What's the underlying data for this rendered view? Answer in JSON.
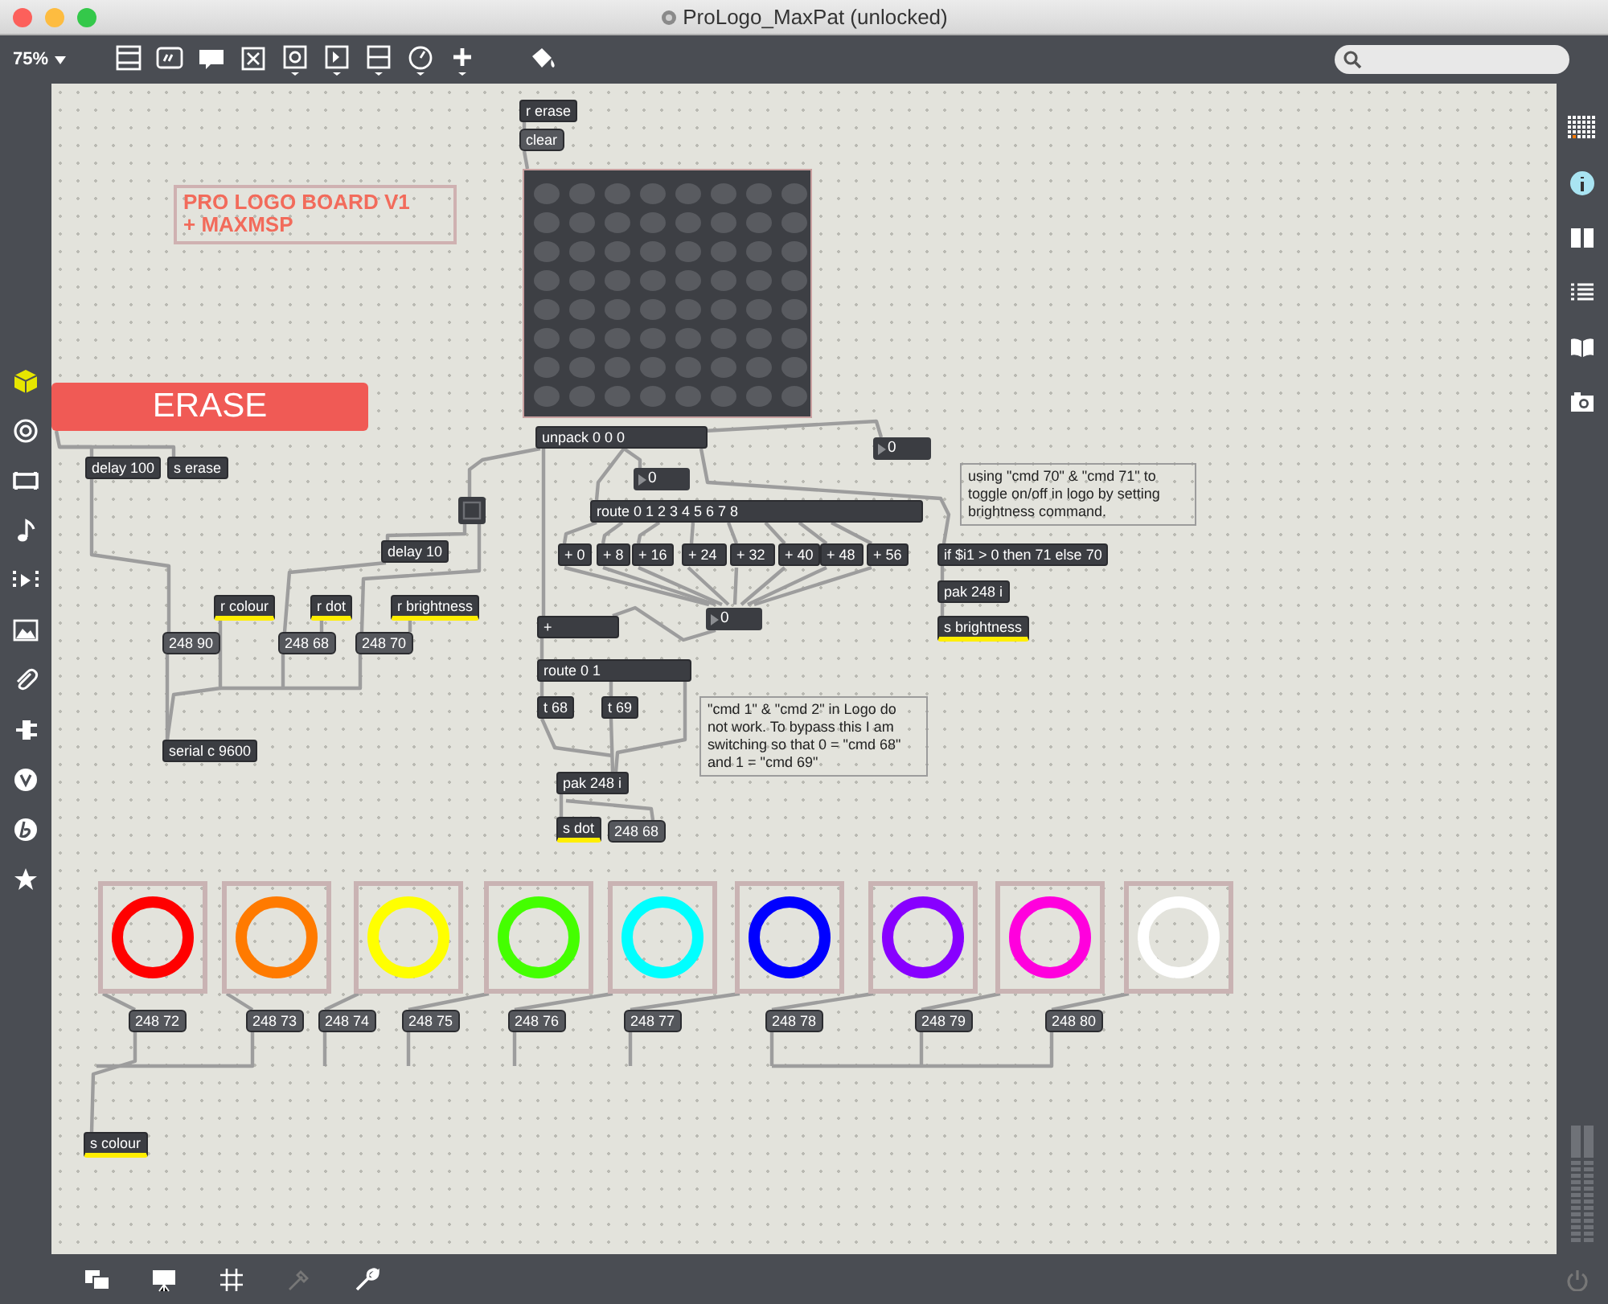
{
  "window": {
    "title": "ProLogo_MaxPat (unlocked)"
  },
  "toolbar": {
    "zoom": "75%"
  },
  "canvas": {
    "objects": [
      {
        "kind": "object",
        "text": "r erase"
      },
      {
        "kind": "message",
        "text": "clear"
      },
      {
        "kind": "matrix"
      },
      {
        "kind": "comment",
        "text": "PRO LOGO BOARD V1\n+ MAXMSP",
        "color": "#f26b5b"
      },
      {
        "kind": "textbutton",
        "text": "ERASE"
      },
      {
        "kind": "object",
        "text": "unpack 0 0 0"
      },
      {
        "kind": "number",
        "text": "0"
      },
      {
        "kind": "object",
        "text": "delay 100"
      },
      {
        "kind": "object",
        "text": "s erase"
      },
      {
        "kind": "number",
        "text": "0"
      },
      {
        "kind": "toggle",
        "on": false
      },
      {
        "kind": "object",
        "text": "route 0 1 2 3 4 5 6 7 8"
      },
      {
        "kind": "comment",
        "text": "using \"cmd 70\" & \"cmd 71\" to toggle on/off in logo by setting brightness command."
      },
      {
        "kind": "object",
        "text": "delay 10"
      },
      {
        "kind": "object",
        "text": "+ 0"
      },
      {
        "kind": "object",
        "text": "+ 8"
      },
      {
        "kind": "object",
        "text": "+ 16"
      },
      {
        "kind": "object",
        "text": "+ 24"
      },
      {
        "kind": "object",
        "text": "+ 32"
      },
      {
        "kind": "object",
        "text": "+ 40"
      },
      {
        "kind": "object",
        "text": "+ 48"
      },
      {
        "kind": "object",
        "text": "+ 56"
      },
      {
        "kind": "object",
        "text": "if $i1 > 0 then 71 else 70"
      },
      {
        "kind": "object",
        "text": "pak 248 i"
      },
      {
        "kind": "object",
        "text": "r colour",
        "highlighted": true
      },
      {
        "kind": "object",
        "text": "r dot",
        "highlighted": true
      },
      {
        "kind": "object",
        "text": "r brightness",
        "highlighted": true
      },
      {
        "kind": "number",
        "text": "0"
      },
      {
        "kind": "object",
        "text": "+"
      },
      {
        "kind": "object",
        "text": "s brightness",
        "highlighted": true
      },
      {
        "kind": "message",
        "text": "248 90"
      },
      {
        "kind": "message",
        "text": "248 68"
      },
      {
        "kind": "message",
        "text": "248 70"
      },
      {
        "kind": "object",
        "text": "route 0 1"
      },
      {
        "kind": "object",
        "text": "t 68"
      },
      {
        "kind": "object",
        "text": "t 69"
      },
      {
        "kind": "comment",
        "text": "\"cmd 1\" & \"cmd 2\" in Logo do not work. To bypass this I am switching so that 0 = \"cmd 68\"  and 1 = \"cmd 69\""
      },
      {
        "kind": "object",
        "text": "serial c 9600"
      },
      {
        "kind": "object",
        "text": "pak 248 i"
      },
      {
        "kind": "object",
        "text": "s dot",
        "highlighted": true
      },
      {
        "kind": "message",
        "text": "248 68"
      },
      {
        "kind": "swatch",
        "color": "#ff0000"
      },
      {
        "kind": "swatch",
        "color": "#ff7a00"
      },
      {
        "kind": "swatch",
        "color": "#ffff00"
      },
      {
        "kind": "swatch",
        "color": "#44ff00"
      },
      {
        "kind": "swatch",
        "color": "#00ffff"
      },
      {
        "kind": "swatch",
        "color": "#0000ff"
      },
      {
        "kind": "swatch",
        "color": "#8800ff"
      },
      {
        "kind": "swatch",
        "color": "#ff00dd"
      },
      {
        "kind": "swatch",
        "color": "#ffffff"
      },
      {
        "kind": "message",
        "text": "248 72"
      },
      {
        "kind": "message",
        "text": "248 73"
      },
      {
        "kind": "message",
        "text": "248 74"
      },
      {
        "kind": "message",
        "text": "248 75"
      },
      {
        "kind": "message",
        "text": "248 76"
      },
      {
        "kind": "message",
        "text": "248 77"
      },
      {
        "kind": "message",
        "text": "248 78"
      },
      {
        "kind": "message",
        "text": "248 79"
      },
      {
        "kind": "message",
        "text": "248 80"
      },
      {
        "kind": "object",
        "text": "s colour",
        "highlighted": true
      }
    ]
  }
}
